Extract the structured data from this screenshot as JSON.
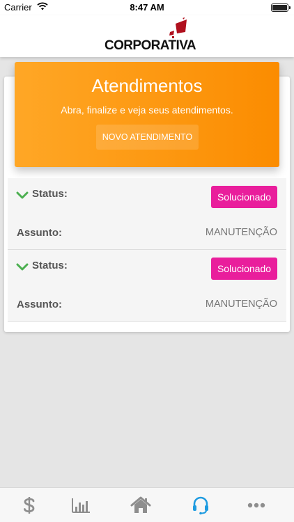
{
  "status_bar": {
    "carrier": "Carrier",
    "time": "8:47 AM"
  },
  "header": {
    "logo_text": "CORPORATIVA",
    "logo_color": "#b0101e"
  },
  "banner": {
    "title": "Atendimentos",
    "subtitle": "Abra, finalize e veja seus atendimentos.",
    "button_label": "NOVO ATENDIMENTO",
    "color_start": "#ffa726",
    "color_end": "#fb8c00"
  },
  "tickets": [
    {
      "status_label": "Status:",
      "status_value": "Solucionado",
      "subject_label": "Assunto:",
      "subject_value": "MANUTENÇÃO"
    },
    {
      "status_label": "Status:",
      "status_value": "Solucionado",
      "subject_label": "Assunto:",
      "subject_value": "MANUTENÇÃO"
    }
  ],
  "tab_bar": {
    "tabs": [
      {
        "icon": "dollar-icon",
        "active": false
      },
      {
        "icon": "bar-chart-icon",
        "active": false
      },
      {
        "icon": "home-icon",
        "active": false
      },
      {
        "icon": "headset-icon",
        "active": true
      },
      {
        "icon": "more-icon",
        "active": false
      }
    ],
    "active_color": "#1e9be0",
    "inactive_color": "#8e8e8e"
  },
  "colors": {
    "badge": "#e91e9c",
    "chevron": "#4caf50"
  }
}
